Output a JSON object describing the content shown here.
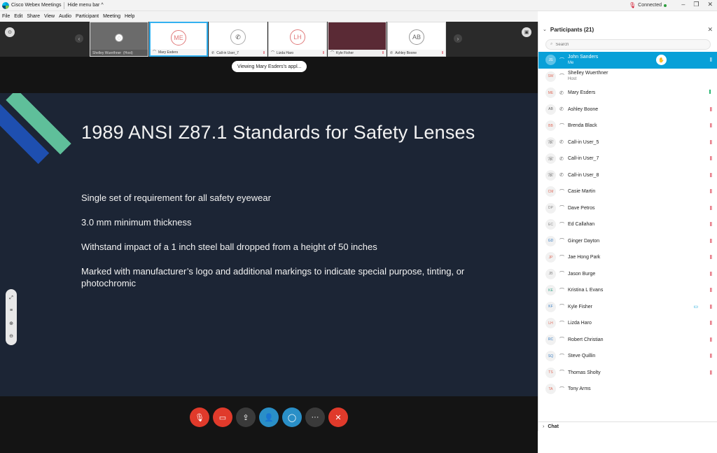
{
  "titlebar": {
    "app_title": "Cisco Webex Meetings",
    "hide_menu": "Hide menu bar ^",
    "status": "Connected"
  },
  "menu": [
    "File",
    "Edit",
    "Share",
    "View",
    "Audio",
    "Participant",
    "Meeting",
    "Help"
  ],
  "filmstrip": [
    {
      "name": "Shelley Wuerthner",
      "extra": "(Host)",
      "initials": "",
      "style": "dark"
    },
    {
      "name": "Mary Esders",
      "initials": "ME",
      "style": "active"
    },
    {
      "name": "Call-in User_7",
      "initials": "☏",
      "style": "phone"
    },
    {
      "name": "Lizda Haro",
      "initials": "LH",
      "style": "normal"
    },
    {
      "name": "Kyle Fisher",
      "initials": "",
      "style": "maroon"
    },
    {
      "name": "Ashley Boone",
      "initials": "AB",
      "style": "gray"
    }
  ],
  "viewing_text": "Viewing Mary Esders's appl...",
  "slide": {
    "title": "1989 ANSI Z87.1 Standards for Safety Lenses",
    "bullets": [
      "Single set of requirement for all safety eyewear",
      "3.0 mm minimum thickness",
      "Withstand impact of a 1 inch steel ball dropped from a height of 50 inches",
      "Marked with manufacturer’s logo and additional markings to indicate special purpose, tinting, or photochromic"
    ]
  },
  "panel": {
    "title": "Participants (21)",
    "search_placeholder": "Search",
    "participants": [
      {
        "initials": "JS",
        "name": "John Sanders",
        "sub": "Me",
        "selected": true
      },
      {
        "initials": "SW",
        "name": "Shelley Wuerthner",
        "sub": "Host"
      },
      {
        "initials": "ME",
        "name": "Mary Esders"
      },
      {
        "initials": "AB",
        "name": "Ashley Boone"
      },
      {
        "initials": "BB",
        "name": "Brenda Black"
      },
      {
        "initials": "☏",
        "name": "Call-in User_5"
      },
      {
        "initials": "☏",
        "name": "Call-in User_7"
      },
      {
        "initials": "☏",
        "name": "Call-in User_8"
      },
      {
        "initials": "CM",
        "name": "Casie Martin"
      },
      {
        "initials": "DP",
        "name": "Dave Petros"
      },
      {
        "initials": "EC",
        "name": "Ed Callahan"
      },
      {
        "initials": "GD",
        "name": "Ginger Dayton"
      },
      {
        "initials": "JP",
        "name": "Jae Hong Park"
      },
      {
        "initials": "JB",
        "name": "Jason Burge"
      },
      {
        "initials": "KE",
        "name": "Kristina L Evans"
      },
      {
        "initials": "KF",
        "name": "Kyle Fisher"
      },
      {
        "initials": "LH",
        "name": "Lizda Haro"
      },
      {
        "initials": "RC",
        "name": "Robert Christian"
      },
      {
        "initials": "SQ",
        "name": "Steve Quillin"
      },
      {
        "initials": "TS",
        "name": "Thomas Sholty"
      },
      {
        "initials": "TA",
        "name": "Tony Arms"
      }
    ]
  },
  "chat": {
    "title": "Chat"
  },
  "colors": {
    "accent": "#08a0d8",
    "end_red": "#e03a2b",
    "slide_bg": "#1c2535"
  },
  "icons": {
    "mute": "mic-muted-icon",
    "audio": "headset-icon",
    "phone": "phone-icon",
    "video": "video-icon"
  }
}
